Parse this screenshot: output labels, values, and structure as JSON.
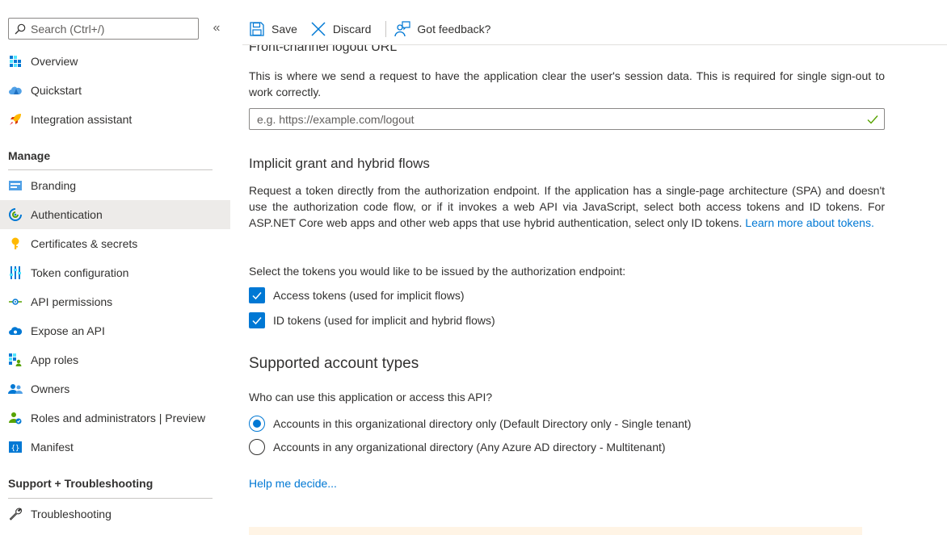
{
  "sidebar": {
    "search_placeholder": "Search (Ctrl+/)",
    "collapse_glyph": "«",
    "top_items": [
      {
        "label": "Overview",
        "icon": "overview-icon"
      },
      {
        "label": "Quickstart",
        "icon": "quickstart-icon"
      },
      {
        "label": "Integration assistant",
        "icon": "rocket-icon"
      }
    ],
    "manage_heading": "Manage",
    "manage_items": [
      {
        "label": "Branding",
        "icon": "branding-icon"
      },
      {
        "label": "Authentication",
        "icon": "authentication-icon",
        "active": true
      },
      {
        "label": "Certificates & secrets",
        "icon": "key-icon"
      },
      {
        "label": "Token configuration",
        "icon": "token-config-icon"
      },
      {
        "label": "API permissions",
        "icon": "api-permissions-icon"
      },
      {
        "label": "Expose an API",
        "icon": "cloud-api-icon"
      },
      {
        "label": "App roles",
        "icon": "app-roles-icon"
      },
      {
        "label": "Owners",
        "icon": "owners-icon"
      },
      {
        "label": "Roles and administrators | Preview",
        "icon": "roles-admin-icon"
      },
      {
        "label": "Manifest",
        "icon": "manifest-icon"
      }
    ],
    "support_heading": "Support + Troubleshooting",
    "support_items": [
      {
        "label": "Troubleshooting",
        "icon": "wrench-icon"
      }
    ]
  },
  "toolbar": {
    "save_label": "Save",
    "discard_label": "Discard",
    "feedback_label": "Got feedback?"
  },
  "main": {
    "logout_heading": "Front-channel logout URL",
    "logout_desc": "This is where we send a request to have the application clear the user's session data. This is required for single sign-out to work correctly.",
    "logout_placeholder": "e.g. https://example.com/logout",
    "implicit_heading": "Implicit grant and hybrid flows",
    "implicit_desc": "Request a token directly from the authorization endpoint. If the application has a single-page architecture (SPA) and doesn't use the authorization code flow, or if it invokes a web API via JavaScript, select both access tokens and ID tokens. For ASP.NET Core web apps and other web apps that use hybrid authentication, select only ID tokens.",
    "implicit_link": "Learn more about tokens.",
    "tokens_prompt": "Select the tokens you would like to be issued by the authorization endpoint:",
    "checkboxes": [
      {
        "label": "Access tokens (used for implicit flows)",
        "checked": true
      },
      {
        "label": "ID tokens (used for implicit and hybrid flows)",
        "checked": true
      }
    ],
    "account_heading": "Supported account types",
    "account_prompt": "Who can use this application or access this API?",
    "radios": [
      {
        "label": "Accounts in this organizational directory only (Default Directory only - Single tenant)",
        "selected": true
      },
      {
        "label": "Accounts in any organizational directory (Any Azure AD directory - Multitenant)",
        "selected": false
      }
    ],
    "help_link": "Help me decide..."
  },
  "colors": {
    "accent": "#0078d4",
    "active_nav_bg": "#edebe9",
    "check_green": "#57a300",
    "warning_bg": "#fff4e5"
  }
}
